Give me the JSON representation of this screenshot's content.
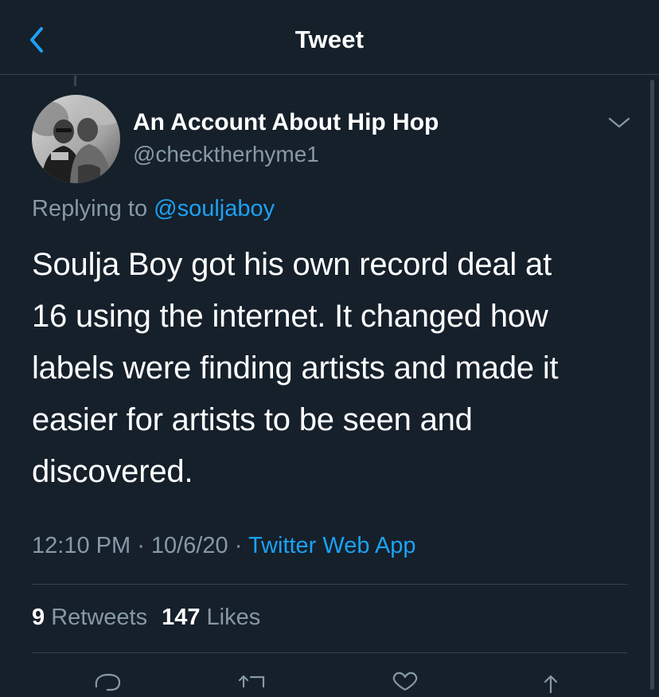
{
  "header": {
    "title": "Tweet",
    "back_icon": "chevron-left-icon"
  },
  "colors": {
    "background": "#15202b",
    "accent": "#1da1f2",
    "secondary_text": "#8899a6",
    "divider": "#38444d"
  },
  "tweet": {
    "author_name": "An Account About Hip Hop",
    "author_handle": "@checktherhyme1",
    "replying_prefix": "Replying to ",
    "replying_to": "@souljaboy",
    "text_lines": [
      "Soulja Boy got his own record deal at",
      "16 using the internet. It changed how",
      "labels were finding artists and made it",
      "easier for artists to be seen and",
      "discovered."
    ],
    "time": "12:10 PM",
    "separator": " · ",
    "date": "10/6/20",
    "source": "Twitter Web App"
  },
  "stats": {
    "retweets_count": "9",
    "retweets_label": " Retweets",
    "likes_count": "147",
    "likes_label": " Likes"
  },
  "actions": {
    "icons": [
      "reply-icon",
      "retweet-icon",
      "like-icon",
      "share-icon"
    ]
  }
}
